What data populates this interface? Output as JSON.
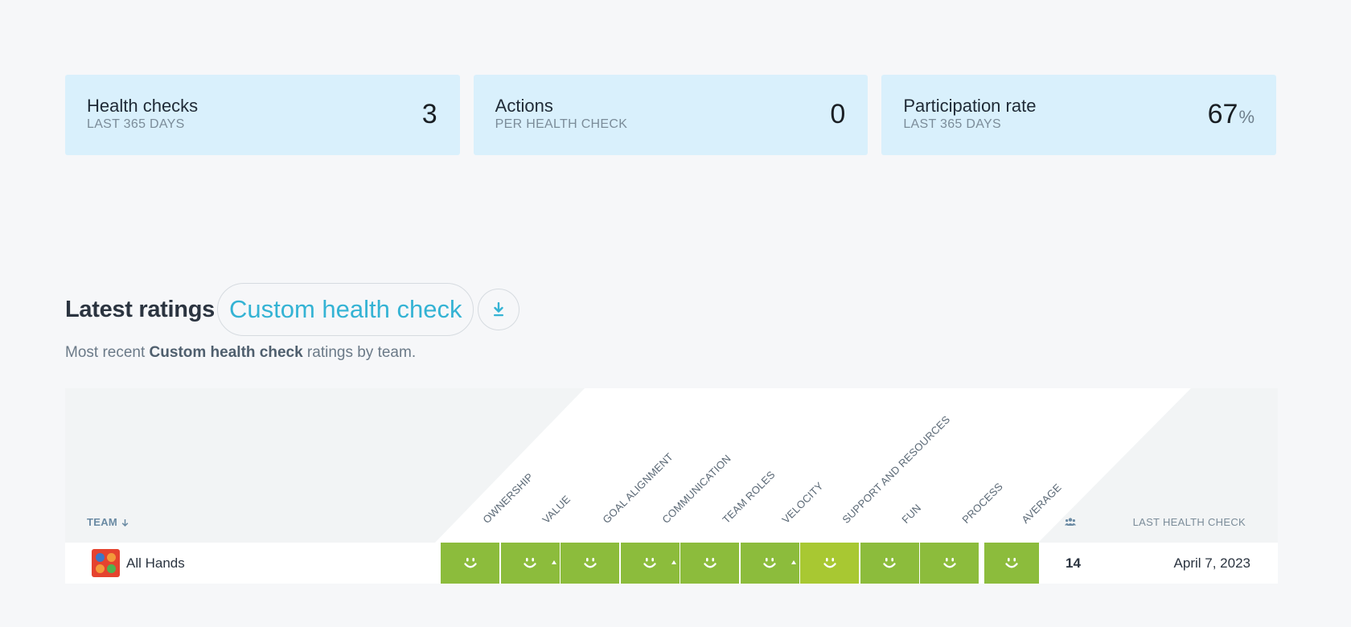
{
  "stats": [
    {
      "title": "Health checks",
      "subtitle": "LAST 365 DAYS",
      "value": "3",
      "unit": ""
    },
    {
      "title": "Actions",
      "subtitle": "PER HEALTH CHECK",
      "value": "0",
      "unit": ""
    },
    {
      "title": "Participation rate",
      "subtitle": "LAST 365 DAYS",
      "value": "67",
      "unit": "%"
    }
  ],
  "ratings": {
    "title": "Latest ratings",
    "selected_check": "Custom health check",
    "download_icon": "download-icon",
    "description_prefix": "Most recent ",
    "description_bold": "Custom health check",
    "description_suffix": " ratings by team."
  },
  "table": {
    "team_header": "TEAM",
    "sort_icon": "arrow-down-icon",
    "participants_icon": "people-icon",
    "last_header": "LAST HEALTH CHECK",
    "columns": [
      "OWNERSHIP",
      "VALUE",
      "GOAL ALIGNMENT",
      "COMMUNICATION",
      "TEAM ROLES",
      "VELOCITY",
      "SUPPORT AND RESOURCES",
      "FUN",
      "PROCESS",
      "AVERAGE"
    ],
    "rows": [
      {
        "team": "All Hands",
        "avatar_icon": "team-avatar-icon",
        "ratings": [
          {
            "face": "smile",
            "color": "#8cbc3c",
            "trend": ""
          },
          {
            "face": "smile",
            "color": "#8cbc3c",
            "trend": "up"
          },
          {
            "face": "smile",
            "color": "#8cbc3c",
            "trend": ""
          },
          {
            "face": "smile",
            "color": "#8cbc3c",
            "trend": "up"
          },
          {
            "face": "smile",
            "color": "#8cbc3c",
            "trend": ""
          },
          {
            "face": "smile",
            "color": "#8cbc3c",
            "trend": "up"
          },
          {
            "face": "smile",
            "color": "#a8c832",
            "trend": ""
          },
          {
            "face": "smile",
            "color": "#8cbc3c",
            "trend": ""
          },
          {
            "face": "smile",
            "color": "#8cbc3c",
            "trend": ""
          }
        ],
        "average": {
          "face": "smile",
          "color": "#8cbc3c"
        },
        "participants": "14",
        "last_check": "April 7, 2023"
      }
    ]
  }
}
